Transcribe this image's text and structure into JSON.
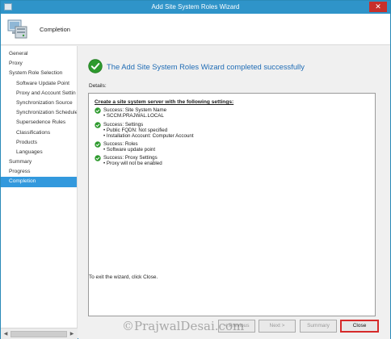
{
  "window": {
    "title": "Add Site System Roles Wizard",
    "close_glyph": "✕"
  },
  "header": {
    "page_title": "Completion"
  },
  "sidebar": {
    "items": [
      {
        "label": "General",
        "level": 0
      },
      {
        "label": "Proxy",
        "level": 0
      },
      {
        "label": "System Role Selection",
        "level": 0
      },
      {
        "label": "Software Update Point",
        "level": 1
      },
      {
        "label": "Proxy and Account Settin",
        "level": 1
      },
      {
        "label": "Synchronization Source",
        "level": 1
      },
      {
        "label": "Synchronization Schedule",
        "level": 1
      },
      {
        "label": "Supersedence Rules",
        "level": 1
      },
      {
        "label": "Classifications",
        "level": 1
      },
      {
        "label": "Products",
        "level": 1
      },
      {
        "label": "Languages",
        "level": 1
      },
      {
        "label": "Summary",
        "level": 0
      },
      {
        "label": "Progress",
        "level": 0
      },
      {
        "label": "Completion",
        "level": 0,
        "active": true
      }
    ],
    "scroll_left": "◀",
    "scroll_right": "▶"
  },
  "main": {
    "success_title": "The Add Site System Roles Wizard completed successfully",
    "details_label": "Details:",
    "details_heading": "Create a site system server with the following settings:",
    "entries": [
      {
        "label": "Success: Site System Name",
        "bullets": [
          "• SCCM.PRAJWAL.LOCAL"
        ]
      },
      {
        "label": "Success: Settings",
        "bullets": [
          "• Public FQDN: Not specified",
          "• Installation Account: Computer Account"
        ]
      },
      {
        "label": "Success: Roles",
        "bullets": [
          "• Software update point"
        ]
      },
      {
        "label": "Success: Proxy Settings",
        "bullets": [
          "• Proxy will not be enabled"
        ]
      }
    ],
    "exit_hint": "To exit the wizard, click Close."
  },
  "buttons": {
    "previous": "< Previous",
    "next": "Next >",
    "summary": "Summary",
    "close": "Close"
  },
  "watermark": "©PrajwalDesai.com",
  "colors": {
    "title_bar": "#2f94c9",
    "accent_text": "#1f6cb5",
    "selected_nav": "#3399dd",
    "success_green": "#2e9a2e",
    "close_highlight": "#d62a2a"
  }
}
